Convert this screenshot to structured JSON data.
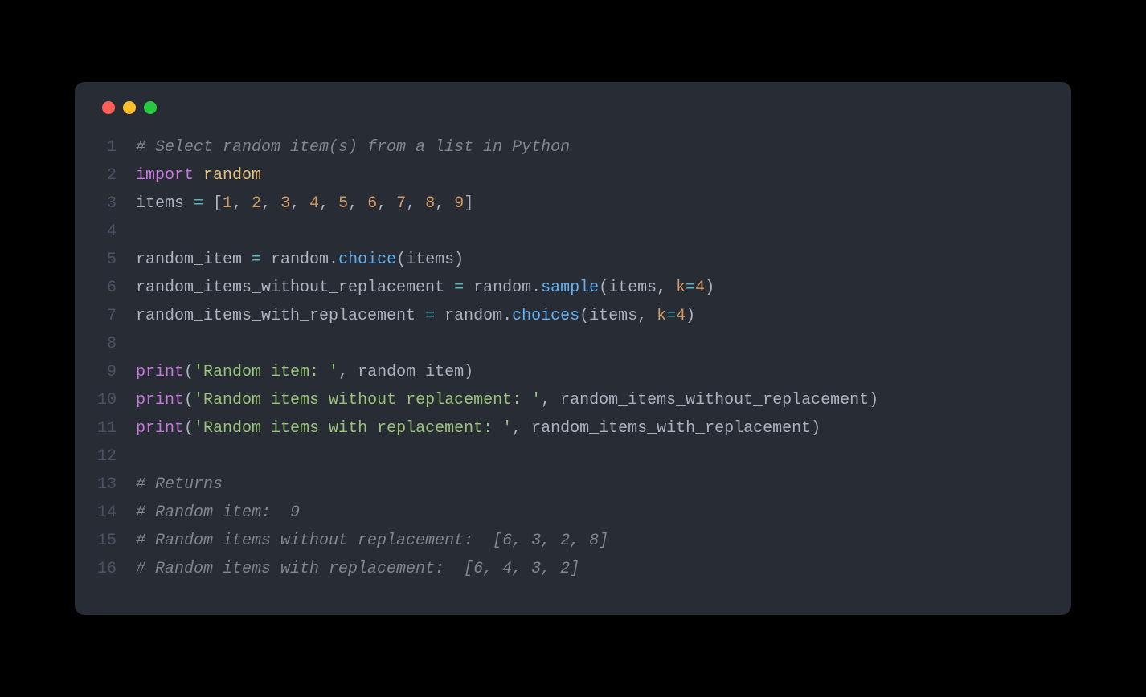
{
  "lines": [
    {
      "n": "1",
      "tokens": [
        [
          "tk-comment",
          "# Select random item(s) from a list in Python"
        ]
      ]
    },
    {
      "n": "2",
      "tokens": [
        [
          "tk-keyword",
          "import"
        ],
        [
          "tk-default",
          " "
        ],
        [
          "tk-module",
          "random"
        ]
      ]
    },
    {
      "n": "3",
      "tokens": [
        [
          "tk-default",
          "items "
        ],
        [
          "tk-op",
          "="
        ],
        [
          "tk-default",
          " ["
        ],
        [
          "tk-num",
          "1"
        ],
        [
          "tk-default",
          ", "
        ],
        [
          "tk-num",
          "2"
        ],
        [
          "tk-default",
          ", "
        ],
        [
          "tk-num",
          "3"
        ],
        [
          "tk-default",
          ", "
        ],
        [
          "tk-num",
          "4"
        ],
        [
          "tk-default",
          ", "
        ],
        [
          "tk-num",
          "5"
        ],
        [
          "tk-default",
          ", "
        ],
        [
          "tk-num",
          "6"
        ],
        [
          "tk-default",
          ", "
        ],
        [
          "tk-num",
          "7"
        ],
        [
          "tk-default",
          ", "
        ],
        [
          "tk-num",
          "8"
        ],
        [
          "tk-default",
          ", "
        ],
        [
          "tk-num",
          "9"
        ],
        [
          "tk-default",
          "]"
        ]
      ]
    },
    {
      "n": "4",
      "tokens": [
        [
          "tk-default",
          ""
        ]
      ]
    },
    {
      "n": "5",
      "tokens": [
        [
          "tk-default",
          "random_item "
        ],
        [
          "tk-op",
          "="
        ],
        [
          "tk-default",
          " random."
        ],
        [
          "tk-func",
          "choice"
        ],
        [
          "tk-default",
          "(items)"
        ]
      ]
    },
    {
      "n": "6",
      "tokens": [
        [
          "tk-default",
          "random_items_without_replacement "
        ],
        [
          "tk-op",
          "="
        ],
        [
          "tk-default",
          " random."
        ],
        [
          "tk-func",
          "sample"
        ],
        [
          "tk-default",
          "(items, "
        ],
        [
          "tk-param",
          "k"
        ],
        [
          "tk-op",
          "="
        ],
        [
          "tk-num",
          "4"
        ],
        [
          "tk-default",
          ")"
        ]
      ]
    },
    {
      "n": "7",
      "tokens": [
        [
          "tk-default",
          "random_items_with_replacement "
        ],
        [
          "tk-op",
          "="
        ],
        [
          "tk-default",
          " random."
        ],
        [
          "tk-func",
          "choices"
        ],
        [
          "tk-default",
          "(items, "
        ],
        [
          "tk-param",
          "k"
        ],
        [
          "tk-op",
          "="
        ],
        [
          "tk-num",
          "4"
        ],
        [
          "tk-default",
          ")"
        ]
      ]
    },
    {
      "n": "8",
      "tokens": [
        [
          "tk-default",
          ""
        ]
      ]
    },
    {
      "n": "9",
      "tokens": [
        [
          "tk-builtin",
          "print"
        ],
        [
          "tk-default",
          "("
        ],
        [
          "tk-string",
          "'Random item: '"
        ],
        [
          "tk-default",
          ", random_item)"
        ]
      ]
    },
    {
      "n": "10",
      "tokens": [
        [
          "tk-builtin",
          "print"
        ],
        [
          "tk-default",
          "("
        ],
        [
          "tk-string",
          "'Random items without replacement: '"
        ],
        [
          "tk-default",
          ", random_items_without_replacement)"
        ]
      ]
    },
    {
      "n": "11",
      "tokens": [
        [
          "tk-builtin",
          "print"
        ],
        [
          "tk-default",
          "("
        ],
        [
          "tk-string",
          "'Random items with replacement: '"
        ],
        [
          "tk-default",
          ", random_items_with_replacement)"
        ]
      ]
    },
    {
      "n": "12",
      "tokens": [
        [
          "tk-default",
          ""
        ]
      ]
    },
    {
      "n": "13",
      "tokens": [
        [
          "tk-comment",
          "# Returns"
        ]
      ]
    },
    {
      "n": "14",
      "tokens": [
        [
          "tk-comment",
          "# Random item:  9"
        ]
      ]
    },
    {
      "n": "15",
      "tokens": [
        [
          "tk-comment",
          "# Random items without replacement:  [6, 3, 2, 8]"
        ]
      ]
    },
    {
      "n": "16",
      "tokens": [
        [
          "tk-comment",
          "# Random items with replacement:  [6, 4, 3, 2]"
        ]
      ]
    }
  ]
}
